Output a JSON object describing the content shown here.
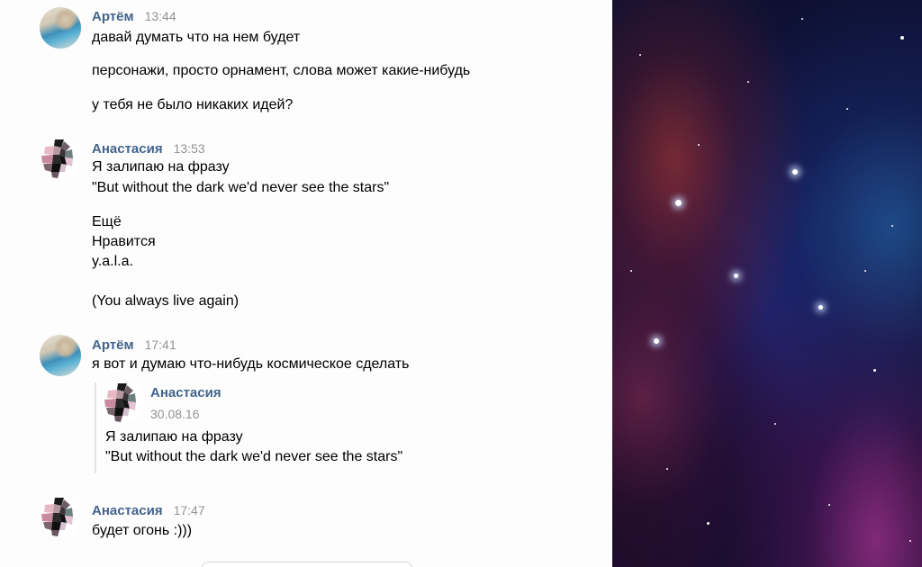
{
  "messages": [
    {
      "author": "Артём",
      "time": "13:44",
      "avatar": "artem-avatar-photo",
      "lines": [
        "давай думать что на нем будет",
        "персонажи, просто орнамент, слова может какие-нибудь",
        "у тебя не было никаких идей?"
      ]
    },
    {
      "author": "Анастасия",
      "time": "13:53",
      "avatar": "nastya-avatar-mosaic",
      "lines": [
        "Я залипаю на фразу",
        "\"But without the dark we'd never see the stars\"",
        "Ещё",
        "Нравится",
        "y.a.l.a.",
        "(You always live again)"
      ]
    },
    {
      "author": "Артём",
      "time": "17:41",
      "avatar": "artem-avatar-photo",
      "lines": [
        "я вот и думаю что-нибудь космическое сделать"
      ],
      "quote": {
        "author": "Анастасия",
        "date": "30.08.16",
        "lines": [
          "Я залипаю на фразу",
          "\"But without the dark we'd never see the stars\""
        ]
      }
    },
    {
      "author": "Анастасия",
      "time": "17:47",
      "avatar": "nastya-avatar-mosaic",
      "lines": [
        "будет огонь :)))"
      ]
    }
  ],
  "colors": {
    "author": "#42648b",
    "time": "#939393",
    "text": "#000000",
    "quote_bar": "#dfe3e8"
  }
}
